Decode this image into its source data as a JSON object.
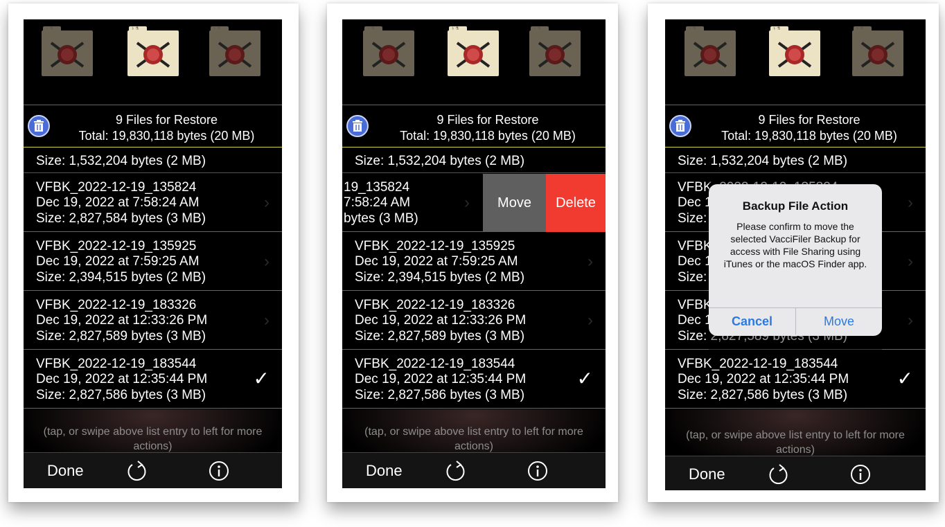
{
  "header": {
    "title": "9 Files for Restore",
    "total": "Total: 19,830,118 bytes (20 MB)"
  },
  "folder_icons": {
    "tab_text": "⚕ ⚗"
  },
  "top_row_size": "Size: 1,532,204 bytes (2 MB)",
  "rows": [
    {
      "name": "VFBK_2022-12-19_135824",
      "date": "Dec 19, 2022 at 7:58:24 AM",
      "size": "Size: 2,827,584 bytes (3 MB)"
    },
    {
      "name": "VFBK_2022-12-19_135925",
      "date": "Dec 19, 2022 at 7:59:25 AM",
      "size": "Size: 2,394,515 bytes (2 MB)"
    },
    {
      "name": "VFBK_2022-12-19_183326",
      "date": "Dec 19, 2022 at 12:33:26 PM",
      "size": "Size: 2,827,589 bytes (3 MB)"
    },
    {
      "name": "VFBK_2022-12-19_183544",
      "date": "Dec 19, 2022 at 12:35:44 PM",
      "size": "Size: 2,827,586 bytes (3 MB)"
    }
  ],
  "swiped_row": {
    "l1": "19_135824",
    "l2": "7:58:24 AM",
    "l3": "bytes (3 MB)",
    "move_label": "Move",
    "delete_label": "Delete"
  },
  "hint": "(tap, or swipe above list entry to left for more actions)",
  "toolbar": {
    "done_label": "Done"
  },
  "dialog": {
    "title": "Backup File Action",
    "message": "Please confirm to move the selected VacciFiler Backup for access with File Sharing using iTunes or the macOS Finder app.",
    "cancel_label": "Cancel",
    "move_label": "Move"
  },
  "colors": {
    "delete": "#f23b30",
    "move": "#5f5f5f",
    "link": "#2a7ae2",
    "trash": "#4a6cd6"
  },
  "icons": [
    "folder-icon",
    "trash-icon",
    "chevron-right-icon",
    "checkmark-icon",
    "refresh-icon",
    "info-icon"
  ]
}
